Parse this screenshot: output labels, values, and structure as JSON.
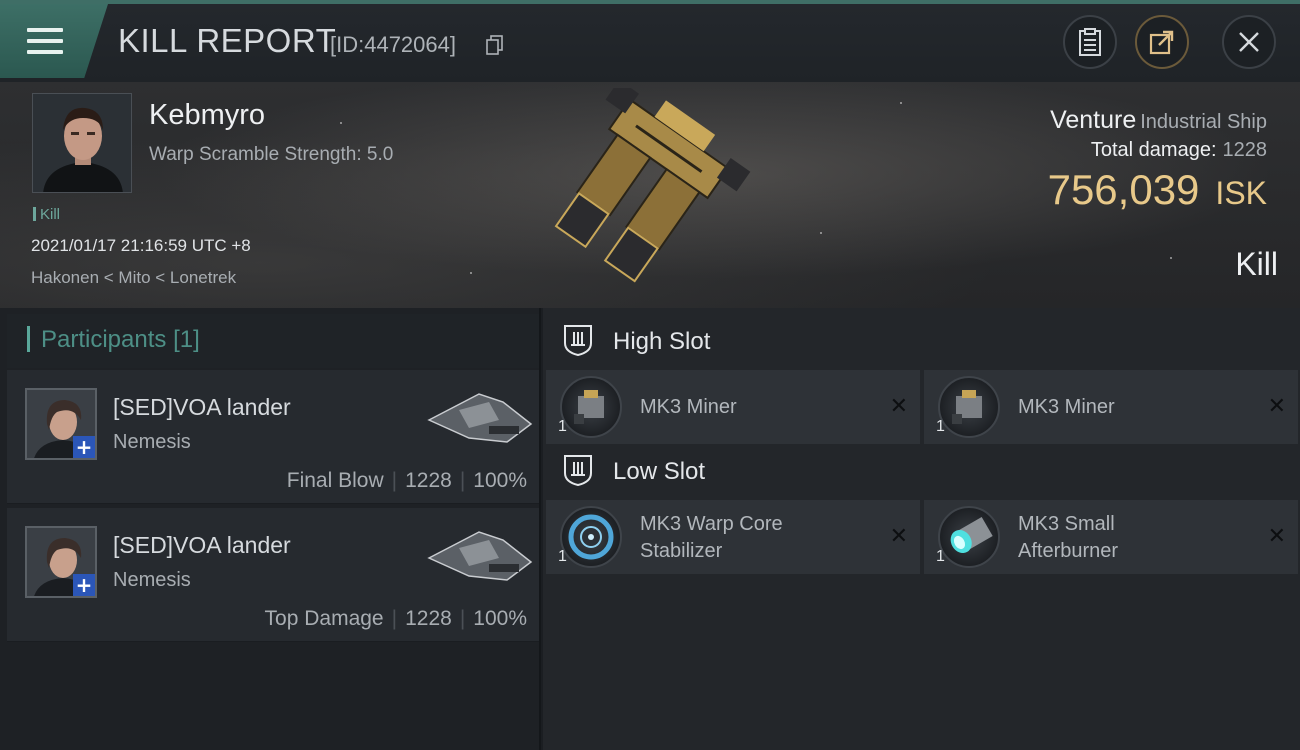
{
  "header": {
    "title": "KILL REPORT",
    "report_id": "[ID:4472064]"
  },
  "victim": {
    "name": "Kebmyro",
    "subtitle": "Warp Scramble Strength: 5.0",
    "tag": "Kill",
    "datetime": "2021/01/17 21:16:59 UTC +8",
    "location": "Hakonen < Mito < Lonetrek"
  },
  "ship": {
    "name": "Venture",
    "class": "Industrial Ship",
    "total_damage_label": "Total damage:",
    "total_damage": "1228",
    "isk_value": "756,039",
    "isk_unit": "ISK",
    "result": "Kill"
  },
  "participants": {
    "title": "Participants",
    "count": "[1]",
    "rows": [
      {
        "name": "[SED]VOA lander",
        "ship": "Nemesis",
        "role": "Final Blow",
        "damage": "1228",
        "percent": "100%"
      },
      {
        "name": "[SED]VOA lander",
        "ship": "Nemesis",
        "role": "Top Damage",
        "damage": "1228",
        "percent": "100%"
      }
    ]
  },
  "fitting": {
    "high_slot": {
      "label": "High Slot",
      "modules": [
        {
          "name": "MK3 Miner",
          "qty": "1"
        },
        {
          "name": "MK3 Miner",
          "qty": "1"
        }
      ]
    },
    "low_slot": {
      "label": "Low Slot",
      "modules": [
        {
          "name_line1": "MK3 Warp Core",
          "name_line2": "Stabilizer",
          "qty": "1"
        },
        {
          "name_line1": "MK3 Small",
          "name_line2": "Afterburner",
          "qty": "1"
        }
      ]
    }
  },
  "icons": {
    "menu": "hamburger-menu-icon",
    "copy": "copy-icon",
    "clipboard": "clipboard-icon",
    "share": "share-icon",
    "close": "close-icon",
    "shield": "shield-slot-icon",
    "remove": "x-icon"
  },
  "colors": {
    "accent": "#3d6f66",
    "isk": "#e8c98a",
    "participants": "#4d8f86"
  }
}
